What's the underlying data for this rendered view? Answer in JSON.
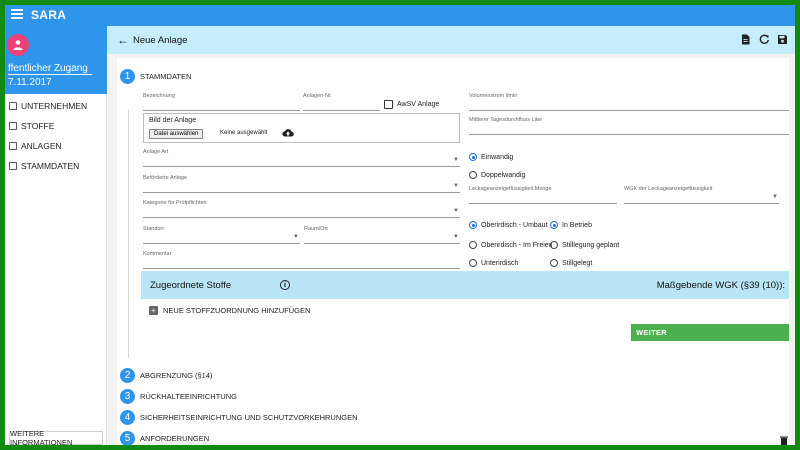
{
  "app": {
    "title": "SARA"
  },
  "sidebar": {
    "user": "ffentlicher Zugang",
    "date": "7.11.2017",
    "items": [
      {
        "label": "UNTERNEHMEN",
        "icon": "building-icon"
      },
      {
        "label": "STOFFE",
        "icon": "document-icon"
      },
      {
        "label": "ANLAGEN",
        "icon": "tune-icon"
      },
      {
        "label": "STAMMDATEN",
        "icon": "keyboard-icon"
      }
    ],
    "more": "WEITERE INFORMATIONEN"
  },
  "header": {
    "title": "Neue Anlage"
  },
  "steps": [
    {
      "num": "1",
      "label": "STAMMDATEN"
    },
    {
      "num": "2",
      "label": "ABGRENZUNG (§14)"
    },
    {
      "num": "3",
      "label": "RÜCKHALTEEINRICHTUNG"
    },
    {
      "num": "4",
      "label": "SICHERHEITSEINRICHTUNG UND SCHUTZVORKEHRUNGEN"
    },
    {
      "num": "5",
      "label": "ANFORDERUNGEN"
    }
  ],
  "form": {
    "bezeichnung": "Bezeichnung",
    "anlagen_nr": "Anlagen-Nr.",
    "awsv": "AwSV Anlage",
    "volumenstrom": "Volumenstrom l/min",
    "tagesdurchfluss": "Mittlerer Tagesdurchfluss Liter",
    "bild_label": "Bild der Anlage",
    "file_button": "Datei auswählen",
    "file_text": "Keine ausgewählt",
    "anlage_art": "Anlage Art",
    "befoerderte": "Beförderte Anlage",
    "kategorie": "Kategorie für Prüfpflichten",
    "standort": "Standort",
    "raum_ort": "Raum/Ort",
    "kommentar": "Kommentar",
    "leckage_menge": "Leckageanzeigeflüssigkeit Menge",
    "wgk_leckage": "WGK der Leckageanzeigeflüssigkeit",
    "wand": [
      "Einwandig",
      "Doppelwandig"
    ],
    "lage": [
      "Oberirdisch - Umbaut",
      "Oberirdisch - Im Freien",
      "Unterirdisch"
    ],
    "status": [
      "In Betrieb",
      "Stilllegung geplant",
      "Stillgelegt"
    ]
  },
  "stoffe": {
    "title": "Zugeordnete Stoffe",
    "wgk": "Maßgebende WGK (§39 (10)):",
    "add": "NEUE STOFFZUORDNUNG HINZUFÜGEN"
  },
  "weiter": "WEITER"
}
